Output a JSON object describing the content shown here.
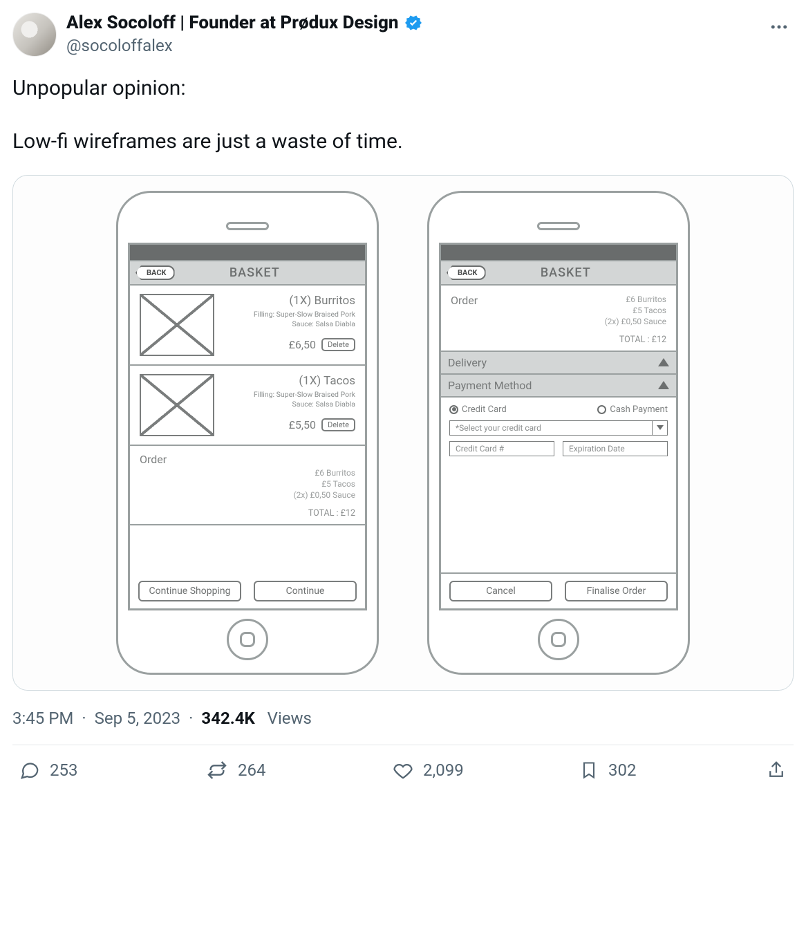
{
  "tweet": {
    "display_name": "Alex Socoloff | Founder at Prødux Design",
    "handle": "@socoloffalex",
    "verified": true,
    "body_line1": "Unpopular opinion:",
    "body_line2": "Low-fi wireframes are just a waste of time.",
    "timestamp": "3:45 PM",
    "date": "Sep 5, 2023",
    "views_count": "342.4K",
    "views_label": "Views"
  },
  "image": {
    "phone1": {
      "back_label": "BACK",
      "title": "BASKET",
      "items": [
        {
          "title": "(1X) Burritos",
          "desc_l1": "Filling: Super-Slow Braised Pork",
          "desc_l2": "Sauce: Salsa Diabla",
          "price": "£6,50",
          "delete": "Delete"
        },
        {
          "title": "(1X) Tacos",
          "desc_l1": "Filling: Super-Slow Braised Pork",
          "desc_l2": "Sauce: Salsa Diabla",
          "price": "£5,50",
          "delete": "Delete"
        }
      ],
      "order_title": "Order",
      "order_l1": "£6 Burritos",
      "order_l2": "£5 Tacos",
      "order_l3": "(2x) £0,50 Sauce",
      "order_total": "TOTAL : £12",
      "btn_left": "Continue Shopping",
      "btn_right": "Continue"
    },
    "phone2": {
      "back_label": "BACK",
      "title": "BASKET",
      "order_title": "Order",
      "order_l1": "£6 Burritos",
      "order_l2": "£5 Tacos",
      "order_l3": "(2x) £0,50 Sauce",
      "order_total": "TOTAL : £12",
      "section_delivery": "Delivery",
      "section_payment": "Payment Method",
      "radio_cc": "Credit Card",
      "radio_cash": "Cash Payment",
      "select_placeholder": "*Select your credit card",
      "field_cc": "Credit Card #",
      "field_exp": "Expiration Date",
      "btn_left": "Cancel",
      "btn_right": "Finalise Order"
    }
  },
  "actions": {
    "replies": "253",
    "retweets": "264",
    "likes": "2,099",
    "bookmarks": "302"
  }
}
